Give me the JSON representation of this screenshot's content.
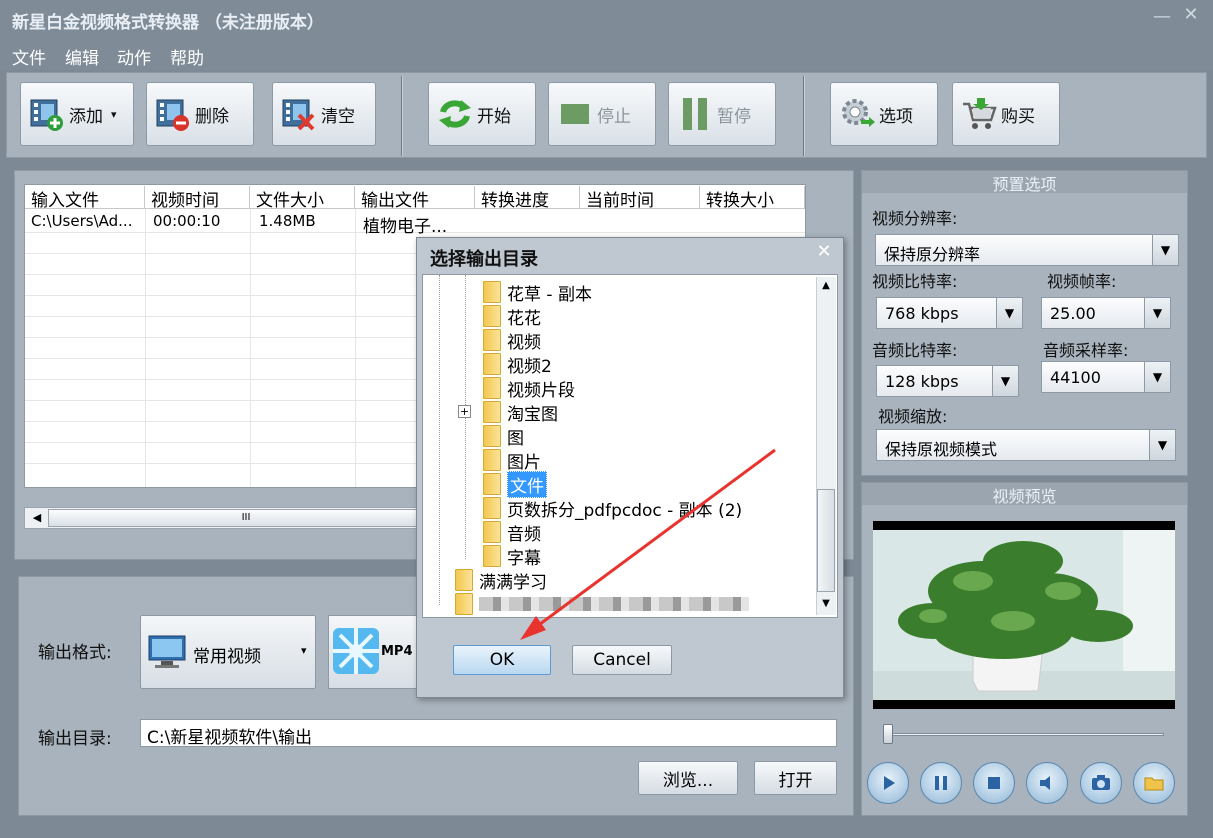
{
  "window": {
    "title": "新星白金视频格式转换器 （未注册版本）",
    "minimize": "—",
    "close": "✕"
  },
  "menu": [
    "文件",
    "编辑",
    "动作",
    "帮助"
  ],
  "toolbar": {
    "add": "添加",
    "delete": "删除",
    "clear": "清空",
    "start": "开始",
    "stop": "停止",
    "pause": "暂停",
    "options": "选项",
    "buy": "购买"
  },
  "file_table": {
    "columns": [
      "输入文件",
      "视频时间",
      "文件大小",
      "输出文件",
      "转换进度",
      "当前时间",
      "转换大小"
    ],
    "rows": [
      {
        "input": "C:\\Users\\Ad...",
        "duration": "00:00:10",
        "size": "1.48MB",
        "output": "植物电子..."
      }
    ],
    "scroll_grip": "III"
  },
  "output": {
    "format_label": "输出格式:",
    "format_value": "常用视频",
    "format_badge": "MP4",
    "dir_label": "输出目录:",
    "dir_value": "C:\\新星视频软件\\输出",
    "browse": "浏览...",
    "open": "打开"
  },
  "preset": {
    "title": "预置选项",
    "resolution_label": "视频分辨率:",
    "resolution_value": "保持原分辨率",
    "vbitrate_label": "视频比特率:",
    "vbitrate_value": "768 kbps",
    "fps_label": "视频帧率:",
    "fps_value": "25.00",
    "abitrate_label": "音频比特率:",
    "abitrate_value": "128 kbps",
    "samplerate_label": "音频采样率:",
    "samplerate_value": "44100",
    "scale_label": "视频缩放:",
    "scale_value": "保持原视频模式"
  },
  "preview": {
    "title": "视频预览"
  },
  "dialog": {
    "title": "选择输出目录",
    "close": "✕",
    "tree_items": [
      {
        "label": "花草 - 副本",
        "level": 2
      },
      {
        "label": "花花",
        "level": 2
      },
      {
        "label": "视频",
        "level": 2
      },
      {
        "label": "视频2",
        "level": 2
      },
      {
        "label": "视频片段",
        "level": 2
      },
      {
        "label": "淘宝图",
        "level": 2,
        "expander": "+"
      },
      {
        "label": "图",
        "level": 2
      },
      {
        "label": "图片",
        "level": 2
      },
      {
        "label": "文件",
        "level": 2,
        "selected": true
      },
      {
        "label": "页数拆分_pdfpcdoc - 副本 (2)",
        "level": 2
      },
      {
        "label": "音频",
        "level": 2
      },
      {
        "label": "字幕",
        "level": 2
      },
      {
        "label": "满满学习",
        "level": 1
      },
      {
        "label": "",
        "level": 1,
        "blurred": true
      }
    ],
    "ok": "OK",
    "cancel": "Cancel"
  },
  "colors": {
    "accent": "#3399ff",
    "arrow": "#e8332e",
    "panel": "#a9b3bd",
    "frame": "#7d8a96"
  }
}
